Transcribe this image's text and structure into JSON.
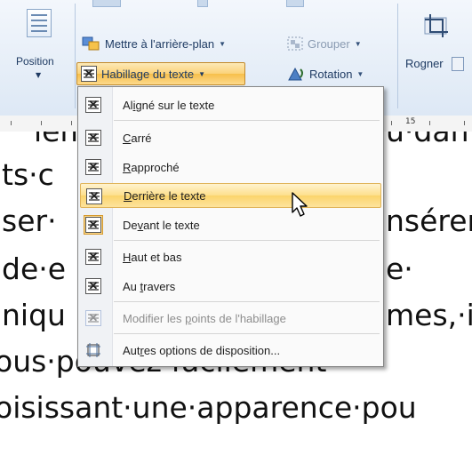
{
  "ribbon": {
    "position": {
      "label": "Position"
    },
    "send_backward": {
      "label": "Mettre à l'arrière-plan",
      "icon": "send-backward-icon"
    },
    "group": {
      "label": "Grouper",
      "icon": "group-icon",
      "enabled": false
    },
    "text_wrap": {
      "label": "Habillage du texte",
      "icon": "text-wrap-icon",
      "active": true
    },
    "rotate": {
      "label": "Rotation",
      "icon": "rotate-icon"
    },
    "crop": {
      "label": "Rogner",
      "icon": "crop-icon"
    }
  },
  "ruler": {
    "label_15": "15"
  },
  "document": {
    "lines": [
      "lem",
      "ts·c",
      "ser·",
      "de·e",
      "niqu",
      "ous·pouvez·facilement·",
      "oisissant·une·apparence·pou"
    ],
    "right_fragments": [
      "u·dan",
      "nsérer",
      "e·",
      "mes,·i"
    ]
  },
  "wrap_menu": {
    "items": [
      {
        "pre": "Al",
        "accel": "i",
        "post": "gné sur le texte",
        "checked": false,
        "hover": false,
        "disabled": false
      },
      {
        "pre": "",
        "accel": "C",
        "post": "arré",
        "checked": false,
        "hover": false,
        "disabled": false
      },
      {
        "pre": "",
        "accel": "R",
        "post": "approché",
        "checked": false,
        "hover": false,
        "disabled": false
      },
      {
        "pre": "",
        "accel": "D",
        "post": "errière le texte",
        "checked": false,
        "hover": true,
        "disabled": false
      },
      {
        "pre": "De",
        "accel": "v",
        "post": "ant le texte",
        "checked": true,
        "hover": false,
        "disabled": false
      },
      {
        "pre": "",
        "accel": "H",
        "post": "aut et bas",
        "checked": false,
        "hover": false,
        "disabled": false
      },
      {
        "pre": "Au ",
        "accel": "t",
        "post": "ravers",
        "checked": false,
        "hover": false,
        "disabled": false
      },
      {
        "pre": "Modifier les ",
        "accel": "p",
        "post": "oints de l'habillage",
        "checked": false,
        "hover": false,
        "disabled": true
      },
      {
        "pre": "Aut",
        "accel": "r",
        "post": "es options de disposition...",
        "checked": false,
        "hover": false,
        "disabled": false
      }
    ]
  },
  "colors": {
    "ribbon_bg": "#dde8f5",
    "hover_highlight": "#fbd46b",
    "checked_bg": "#fcd98c"
  }
}
